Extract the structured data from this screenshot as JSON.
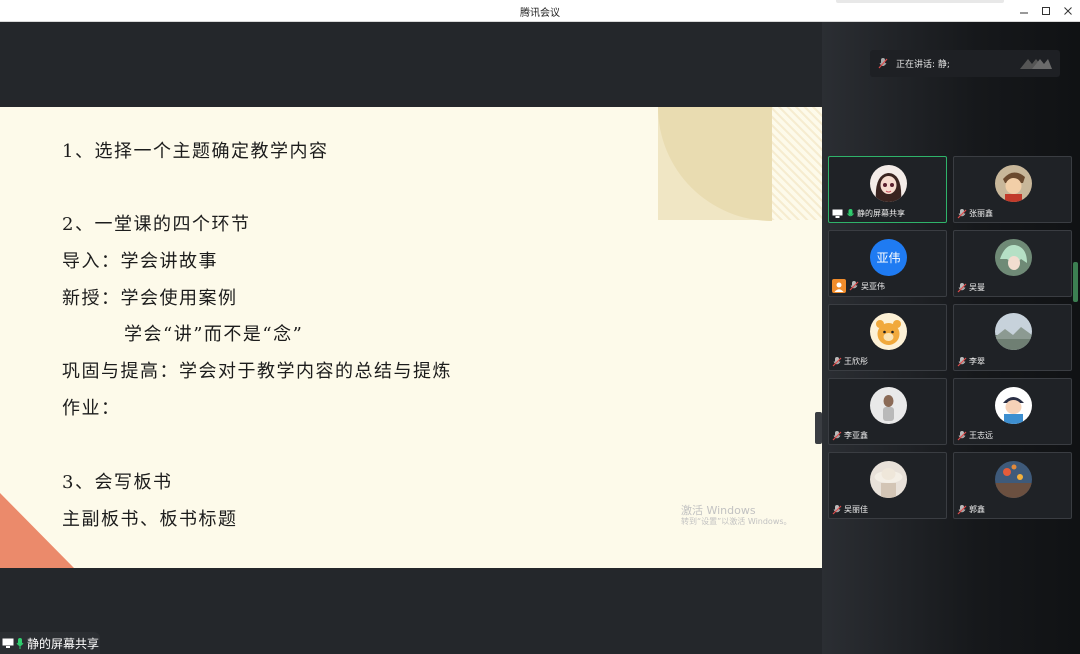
{
  "window": {
    "title": "腾讯会议"
  },
  "slide": {
    "lines": [
      "1、选择一个主题确定教学内容",
      "2、一堂课的四个环节",
      "导入：学会讲故事",
      "新授：学会使用案例",
      "学会“讲”而不是“念”",
      "巩固与提高：学会对于教学内容的总结与提炼",
      "作业：",
      "3、会写板书",
      "主副板书、板书标题"
    ],
    "watermark_title": "激活 Windows",
    "watermark_sub": "转到“设置”以激活 Windows。"
  },
  "share_label": "静的屏幕共享",
  "speaking": {
    "text": "正在讲话: 静;"
  },
  "participants": [
    {
      "name": "静的屏幕共享",
      "avatar": "anime-girl-avatar",
      "active": true
    },
    {
      "name": "张丽鑫",
      "avatar": "cartoon-avatar"
    },
    {
      "name": "吴亚伟",
      "avatar": "text-avatar",
      "avatar_text": "亚伟"
    },
    {
      "name": "吴曼",
      "avatar": "anime-avatar"
    },
    {
      "name": "王欣彤",
      "avatar": "bear-avatar"
    },
    {
      "name": "李翠",
      "avatar": "landscape-avatar"
    },
    {
      "name": "李亚鑫",
      "avatar": "girl-avatar"
    },
    {
      "name": "王志远",
      "avatar": "cartoon-boy-avatar"
    },
    {
      "name": "吴丽佳",
      "avatar": "hat-avatar"
    },
    {
      "name": "郭鑫",
      "avatar": "balloon-avatar"
    }
  ],
  "colors": {
    "active_border": "#2fb36a",
    "slide_bg": "#fdfaea",
    "coral": "#eb8a6b",
    "text_avatar_bg": "#1f7bf2"
  }
}
